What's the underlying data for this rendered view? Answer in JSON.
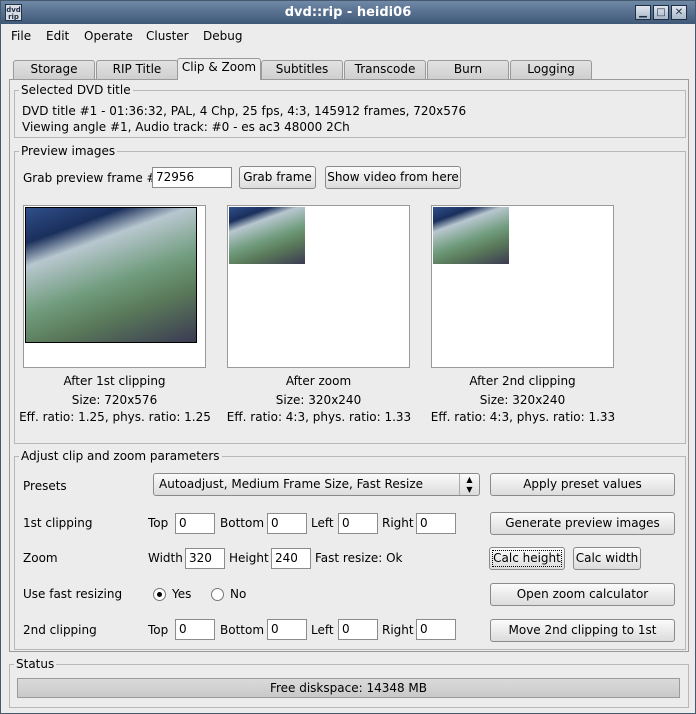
{
  "window": {
    "title": "dvd::rip - heidi06",
    "icon_text": "rip"
  },
  "menu": [
    "File",
    "Edit",
    "Operate",
    "Cluster",
    "Debug"
  ],
  "tabs": [
    "Storage",
    "RIP Title",
    "Clip & Zoom",
    "Subtitles",
    "Transcode",
    "Burn",
    "Logging"
  ],
  "selected_title": {
    "label": "Selected DVD title",
    "line1": "DVD title #1 - 01:36:32, PAL, 4 Chp, 25 fps, 4:3, 145912 frames, 720x576",
    "line2": "Viewing angle #1, Audio track: #0 - es ac3 48000 2Ch"
  },
  "preview": {
    "label": "Preview images",
    "grab_label": "Grab preview frame #",
    "frame_value": "72956",
    "grab_button": "Grab frame",
    "show_button": "Show video from here",
    "images": [
      {
        "caption": "After 1st clipping",
        "size": "Size: 720x576",
        "ratio": "Eff. ratio: 1.25, phys. ratio: 1.25"
      },
      {
        "caption": "After zoom",
        "size": "Size: 320x240",
        "ratio": "Eff. ratio: 4:3, phys. ratio: 1.33"
      },
      {
        "caption": "After 2nd clipping",
        "size": "Size: 320x240",
        "ratio": "Eff. ratio: 4:3, phys. ratio: 1.33"
      }
    ]
  },
  "adjust": {
    "label": "Adjust clip and zoom parameters",
    "presets_label": "Presets",
    "preset_value": "Autoadjust, Medium Frame Size, Fast Resize",
    "apply_button": "Apply preset values",
    "clip1_label": "1st clipping",
    "top_label": "Top",
    "bottom_label": "Bottom",
    "left_label": "Left",
    "right_label": "Right",
    "clip1": {
      "top": "0",
      "bottom": "0",
      "left": "0",
      "right": "0"
    },
    "generate_button": "Generate preview images",
    "zoom_label": "Zoom",
    "width_label": "Width",
    "height_label": "Height",
    "width_value": "320",
    "height_value": "240",
    "fast_resize_status": "Fast resize: Ok",
    "calc_height_button": "Calc height",
    "calc_width_button": "Calc width",
    "fast_resizing_label": "Use fast resizing",
    "yes_label": "Yes",
    "no_label": "No",
    "zoom_calc_button": "Open zoom calculator",
    "clip2_label": "2nd clipping",
    "clip2": {
      "top": "0",
      "bottom": "0",
      "left": "0",
      "right": "0"
    },
    "move_button": "Move 2nd clipping to 1st"
  },
  "status": {
    "label": "Status",
    "text": "Free diskspace: 14348 MB"
  }
}
